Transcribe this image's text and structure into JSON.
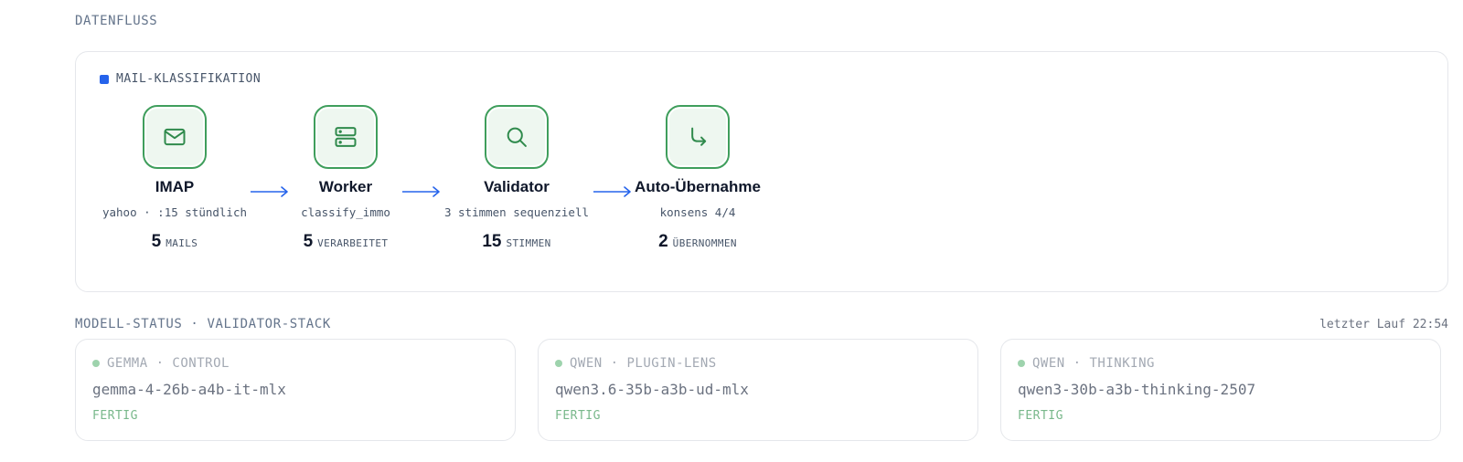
{
  "dataflow": {
    "section_title": "DATENFLUSS",
    "pipeline_label": "MAIL-KLASSIFIKATION",
    "accent_color": "#2563eb",
    "stage_color": "#3f9e5c",
    "stages": [
      {
        "icon": "mail-icon",
        "name": "IMAP",
        "sub": "yahoo · :15 stündlich",
        "count": "5",
        "unit": "MAILS"
      },
      {
        "icon": "server-icon",
        "name": "Worker",
        "sub": "classify_immo",
        "count": "5",
        "unit": "VERARBEITET"
      },
      {
        "icon": "search-icon",
        "name": "Validator",
        "sub": "3 stimmen sequenziell",
        "count": "15",
        "unit": "STIMMEN"
      },
      {
        "icon": "corner-down-right-icon",
        "name": "Auto-Übernahme",
        "sub": "konsens 4/4",
        "count": "2",
        "unit": "ÜBERNOMMEN"
      }
    ]
  },
  "models": {
    "section_title": "MODELL-STATUS · VALIDATOR-STACK",
    "last_run": "letzter Lauf 22:54",
    "status_color": "#79b88b",
    "cards": [
      {
        "tag": "GEMMA · CONTROL",
        "name": "gemma-4-26b-a4b-it-mlx",
        "status": "FERTIG"
      },
      {
        "tag": "QWEN · PLUGIN-LENS",
        "name": "qwen3.6-35b-a3b-ud-mlx",
        "status": "FERTIG"
      },
      {
        "tag": "QWEN · THINKING",
        "name": "qwen3-30b-a3b-thinking-2507",
        "status": "FERTIG"
      }
    ]
  }
}
